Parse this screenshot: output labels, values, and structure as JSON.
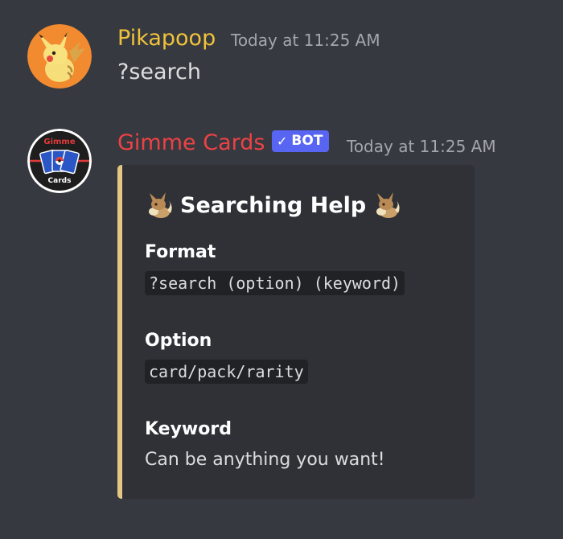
{
  "messages": [
    {
      "username": "Pikapoop",
      "timestamp": "Today at 11:25 AM",
      "content": "?search",
      "username_color": "#f0c23b",
      "avatar": "pikachu-avatar"
    },
    {
      "username": "Gimme Cards",
      "timestamp": "Today at 11:25 AM",
      "username_color": "#ed4245",
      "avatar": "gimme-cards-avatar",
      "avatar_text_top": "Gimme",
      "avatar_text_bottom": "Cards",
      "badge": {
        "check": "✓",
        "label": "BOT",
        "color": "#5865f2"
      },
      "embed": {
        "accent_color": "#e6c683",
        "title": "Searching Help",
        "title_emoji": "eevee-emoji",
        "fields": [
          {
            "name": "Format",
            "value": "?search (option) (keyword)",
            "code": true
          },
          {
            "name": "Option",
            "value": "card/pack/rarity",
            "code": true
          },
          {
            "name": "Keyword",
            "value": "Can be anything you want!",
            "code": false
          }
        ]
      }
    }
  ]
}
